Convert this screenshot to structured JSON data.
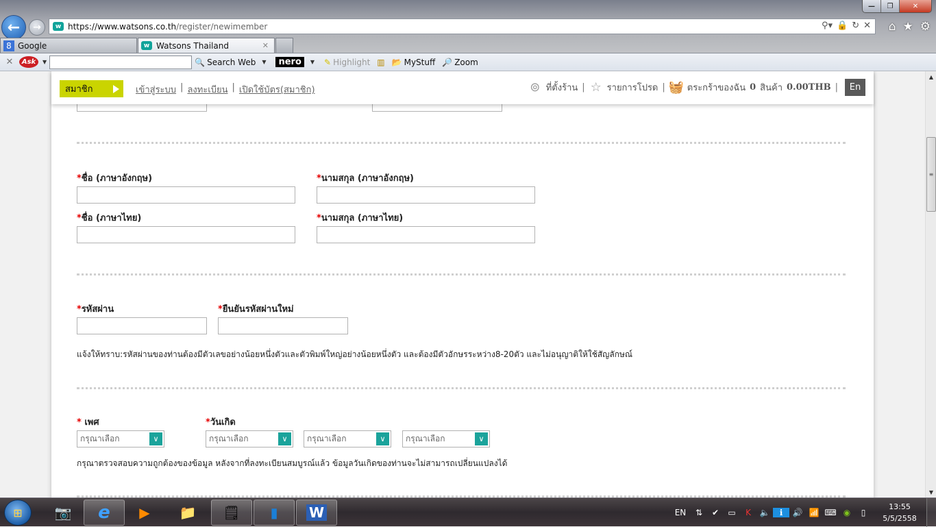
{
  "browser": {
    "window_controls": {
      "minimize": "—",
      "maximize": "❐",
      "close": "✕"
    },
    "url_host": "https://www.watsons.co.th",
    "url_path": "/register/newimember",
    "address_icons": {
      "search": "⚲▾",
      "lock": "🔒",
      "refresh": "↻",
      "stop": "✕"
    },
    "right_icons": {
      "home": "⌂",
      "favorites": "★",
      "tools": "⚙"
    },
    "tabs": [
      {
        "label": "Google",
        "icon": "8",
        "active": false
      },
      {
        "label": "Watsons Thailand",
        "icon": "w",
        "active": true,
        "close": "✕"
      }
    ],
    "toolbar": {
      "close": "✕",
      "ask_logo": "Ask",
      "ask_input_value": "",
      "search_web": "Search Web",
      "nero": "nero",
      "highlight": "Highlight",
      "mystuff": "MyStuff",
      "zoom": "Zoom"
    }
  },
  "site_header": {
    "member_button": "สมาชิก",
    "auth_links": [
      "เข้าสู่ระบบ",
      "ลงทะเบียน",
      "เปิดใช้บัตร(สมาชิก)"
    ],
    "separator": "|",
    "store_locator": "ที่ตั้งร้าน",
    "wishlist": "รายการโปรด",
    "cart_label": "ตระกร้าของฉัน",
    "cart_count": "0",
    "cart_items_label": "สินค้า",
    "cart_total": "0.00THB",
    "language": "En"
  },
  "form": {
    "required_mark": "*",
    "first_name_en": {
      "label": "ชื่อ (ภาษาอังกฤษ)",
      "value": ""
    },
    "last_name_en": {
      "label": "นามสกุล (ภาษาอังกฤษ)",
      "value": ""
    },
    "first_name_th": {
      "label": "ชื่อ (ภาษาไทย)",
      "value": ""
    },
    "last_name_th": {
      "label": "นามสกุล (ภาษาไทย)",
      "value": ""
    },
    "password": {
      "label": "รหัสผ่าน",
      "value": ""
    },
    "confirm_password": {
      "label": "ยืนยันรหัสผ่านใหม่",
      "value": ""
    },
    "password_note": "แจ้งให้ทราบ:รหัสผ่านของท่านต้องมีตัวเลขอย่างน้อยหนึ่งตัวและตัวพิมพ์ใหญ่อย่างน้อยหนึ่งตัว และต้องมีตัวอักษรระหว่าง8-20ตัว และไม่อนุญาติให้ใช้สัญลักษณ์",
    "gender": {
      "label": " เพศ",
      "selected": "กรุณาเลือก"
    },
    "birthday": {
      "label": "วันเกิด",
      "day": "กรุณาเลือก",
      "month": "กรุณาเลือก",
      "year": "กรุณาเลือก"
    },
    "birthday_note": "กรุณาตรวจสอบความถูกต้องของข้อมูล หลังจากที่ลงทะเบียนสมบูรณ์แล้ว ข้อมูลวันเกิดของท่านจะไม่สามารถเปลี่ยนแปลงได้",
    "dropdown_arrow": "∨"
  },
  "scrollbar": {
    "up": "▲",
    "down": "▼",
    "grip": "≡",
    "position": 0.28
  },
  "taskbar": {
    "start": "⊞",
    "apps": [
      {
        "name": "camera",
        "icon": "📷"
      },
      {
        "name": "internet-explorer",
        "icon": "e"
      },
      {
        "name": "media-player",
        "icon": "▶"
      },
      {
        "name": "file-explorer",
        "icon": "📁"
      },
      {
        "name": "sticky-notes",
        "icon": "🗒"
      },
      {
        "name": "device-app",
        "icon": "▮"
      },
      {
        "name": "word",
        "icon": "W"
      }
    ],
    "tray": {
      "language": "EN",
      "icons": [
        "⇅",
        "✔",
        "▭",
        "K",
        "🔈",
        "ℹ",
        "🔊",
        "📶",
        "⌨",
        "◉",
        "▯"
      ],
      "time": "13:55",
      "date": "5/5/2558"
    }
  }
}
